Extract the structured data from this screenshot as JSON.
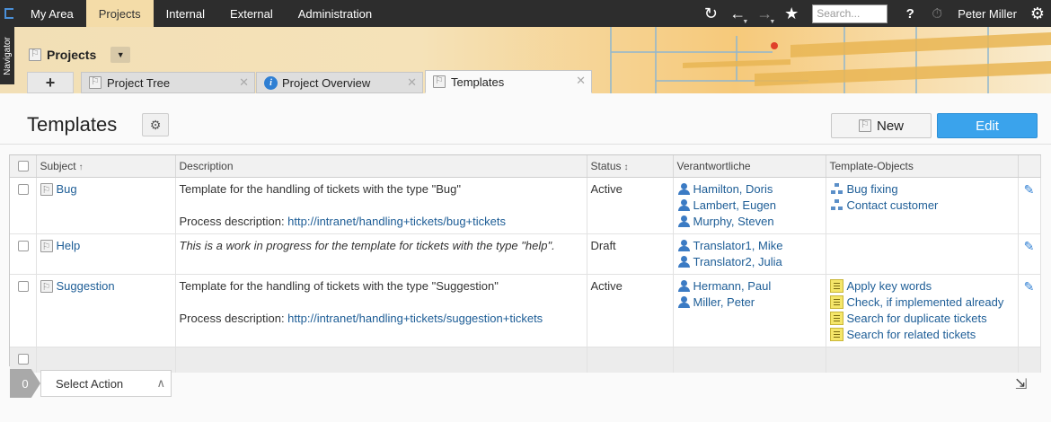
{
  "topnav": {
    "tabs": [
      "My Area",
      "Projects",
      "Internal",
      "External",
      "Administration"
    ],
    "active_index": 1,
    "search_placeholder": "Search...",
    "user": "Peter Miller",
    "icons": [
      "refresh-icon",
      "back-icon",
      "forward-icon",
      "star-icon",
      "help-icon",
      "timer-icon",
      "gear-icon"
    ]
  },
  "navigator_label": "Navigator",
  "header": {
    "title": "Projects"
  },
  "tabs": {
    "items": [
      {
        "label": "Project Tree"
      },
      {
        "label": "Project Overview"
      },
      {
        "label": "Templates"
      }
    ]
  },
  "page": {
    "title": "Templates",
    "new_label": "New",
    "edit_label": "Edit"
  },
  "grid": {
    "columns": [
      "Subject",
      "Description",
      "Status",
      "Verantwortliche",
      "Template-Objects"
    ],
    "rows": [
      {
        "subject": "Bug",
        "desc_1": "Template for the handling of tickets with the type \"Bug\"",
        "desc_2_prefix": "Process description: ",
        "desc_2_link": "http://intranet/handling+tickets/bug+tickets",
        "status": "Active",
        "people": [
          "Hamilton, Doris",
          "Lambert, Eugen",
          "Murphy, Steven"
        ],
        "objects": [
          "Bug fixing",
          "Contact customer"
        ]
      },
      {
        "subject": "Help",
        "desc_1": "This is a work in progress for the template for tickets with the type \"help\".",
        "status": "Draft",
        "people": [
          "Translator1, Mike",
          "Translator2, Julia"
        ],
        "objects": []
      },
      {
        "subject": "Suggestion",
        "desc_1": "Template for the handling of tickets with the type \"Suggestion\"",
        "desc_2_prefix": "Process description: ",
        "desc_2_link": "http://intranet/handling+tickets/suggestion+tickets",
        "status": "Active",
        "people": [
          "Hermann, Paul",
          "Miller, Peter"
        ],
        "objects": [
          "Apply key words",
          "Check, if implemented already",
          "Search for duplicate tickets",
          "Search for related tickets"
        ]
      }
    ]
  },
  "actions": {
    "count": "0",
    "select_label": "Select Action"
  }
}
